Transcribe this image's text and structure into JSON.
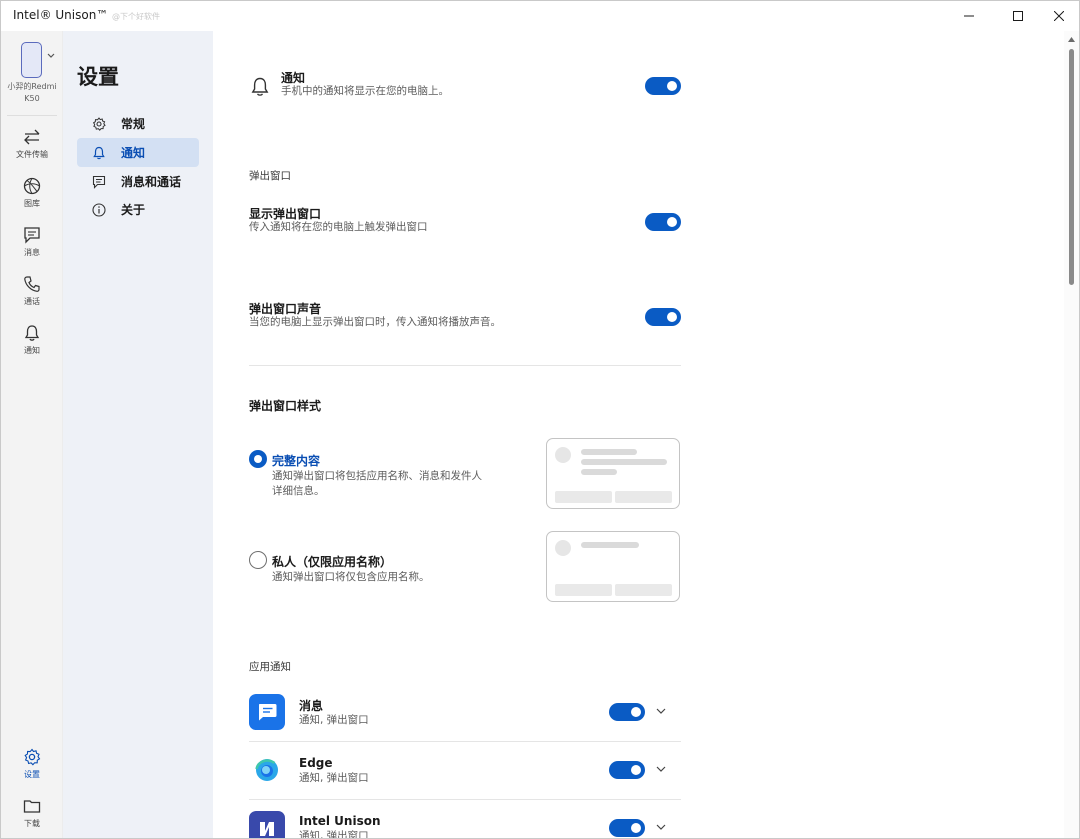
{
  "window": {
    "title": "Intel® Unison™",
    "watermark": "@下个好软件"
  },
  "device": {
    "name": "小羿的Redmi K50"
  },
  "rail": {
    "items": [
      {
        "label": "文件传输",
        "icon": "transfer-icon"
      },
      {
        "label": "图库",
        "icon": "gallery-icon"
      },
      {
        "label": "消息",
        "icon": "message-icon"
      },
      {
        "label": "通话",
        "icon": "phone-icon"
      },
      {
        "label": "通知",
        "icon": "bell-icon"
      }
    ],
    "bottom": [
      {
        "label": "设置",
        "icon": "gear-icon"
      },
      {
        "label": "下载",
        "icon": "folder-icon"
      }
    ]
  },
  "nav": {
    "title": "设置",
    "items": [
      {
        "label": "常规",
        "icon": "gear-icon"
      },
      {
        "label": "通知",
        "icon": "bell-icon",
        "active": true
      },
      {
        "label": "消息和通话",
        "icon": "chat-icon"
      },
      {
        "label": "关于",
        "icon": "info-icon"
      }
    ]
  },
  "main": {
    "notify": {
      "title": "通知",
      "desc": "手机中的通知将显示在您的电脑上。",
      "on": true
    },
    "popup_section": "弹出窗口",
    "show_popup": {
      "title": "显示弹出窗口",
      "desc": "传入通知将在您的电脑上触发弹出窗口",
      "on": true
    },
    "popup_sound": {
      "title": "弹出窗口声音",
      "desc": "当您的电脑上显示弹出窗口时，传入通知将播放声音。",
      "on": true
    },
    "style_title": "弹出窗口样式",
    "style_full": {
      "title": "完整内容",
      "desc_line1": "通知弹出窗口将包括应用名称、消息和发件人",
      "desc_line2": "详细信息。",
      "selected": true
    },
    "style_private": {
      "title": "私人（仅限应用名称）",
      "desc": "通知弹出窗口将仅包含应用名称。",
      "selected": false
    },
    "apps_section": "应用通知",
    "apps": [
      {
        "name": "消息",
        "desc": "通知, 弹出窗口",
        "icon": "messages-app-icon",
        "on": true
      },
      {
        "name": "Edge",
        "desc": "通知, 弹出窗口",
        "icon": "edge-app-icon",
        "on": true
      },
      {
        "name": "Intel Unison",
        "desc": "通知, 弹出窗口",
        "icon": "unison-app-icon",
        "on": true
      }
    ]
  },
  "colors": {
    "accent": "#0a5bc4",
    "nav_active_bg": "#d3e0f3",
    "nav_bg": "#eef1f7",
    "rail_bg": "#f3f3f3"
  }
}
